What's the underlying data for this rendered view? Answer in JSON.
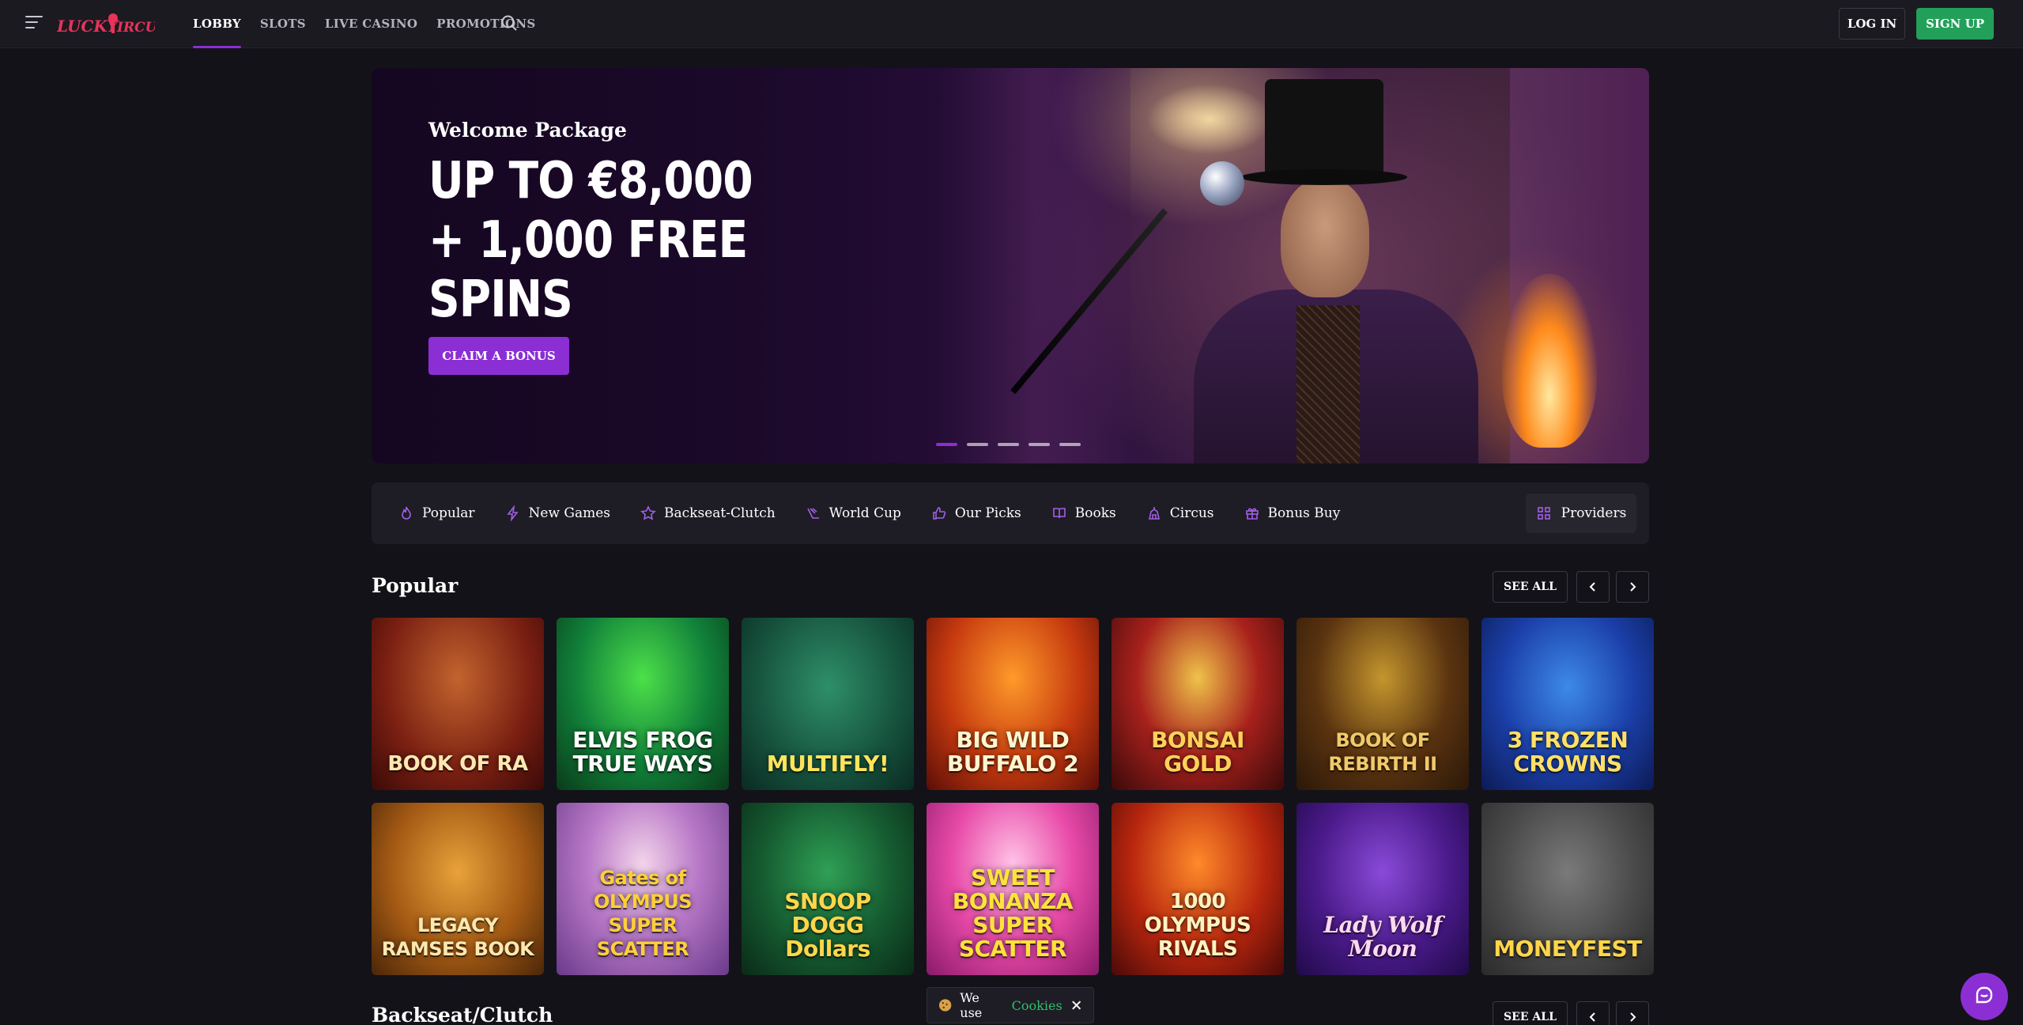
{
  "header": {
    "logo_text": "LUCKY CIRCUS",
    "nav": [
      "LOBBY",
      "SLOTS",
      "LIVE CASINO",
      "PROMOTIONS"
    ],
    "active_nav": "LOBBY",
    "login": "LOG IN",
    "signup": "SIGN UP"
  },
  "hero": {
    "subtitle": "Welcome Package",
    "title": "UP TO €8,000 + 1,000 FREE SPINS",
    "cta": "CLAIM A BONUS",
    "slide_count": 5,
    "active_slide": 1
  },
  "categories": [
    {
      "label": "Popular",
      "icon": "flame-icon"
    },
    {
      "label": "New Games",
      "icon": "lightning-icon"
    },
    {
      "label": "Backseat-Clutch",
      "icon": "star-icon"
    },
    {
      "label": "World Cup",
      "icon": "world-cup-icon"
    },
    {
      "label": "Our Picks",
      "icon": "thumbs-up-icon"
    },
    {
      "label": "Books",
      "icon": "book-icon"
    },
    {
      "label": "Circus",
      "icon": "circus-tent-icon"
    },
    {
      "label": "Bonus Buy",
      "icon": "gift-icon"
    }
  ],
  "providers": "Providers",
  "sections": {
    "popular": {
      "title": "Popular",
      "see_all": "SEE ALL",
      "games": [
        "BOOK OF RA",
        "ELVIS FROG TRUE WAYS",
        "MULTIFLY!",
        "BIG WILD BUFFALO 2",
        "BONSAI GOLD",
        "BOOK OF REBIRTH II",
        "3 FROZEN CROWNS",
        "LEGACY RAMSES BOOK",
        "Gates of OLYMPUS SUPER SCATTER",
        "SNOOP DOGG Dollars",
        "SWEET BONANZA SUPER SCATTER",
        "1000 OLYMPUS RIVALS",
        "Lady Wolf Moon",
        "MONEYFEST"
      ]
    },
    "backseat": {
      "title": "Backseat/Clutch",
      "see_all": "SEE ALL"
    }
  },
  "cookie": {
    "text": "We use",
    "link": "Cookies"
  },
  "colors": {
    "accent": "#8b2fd4",
    "signup": "#22a05a",
    "background": "#131218"
  }
}
